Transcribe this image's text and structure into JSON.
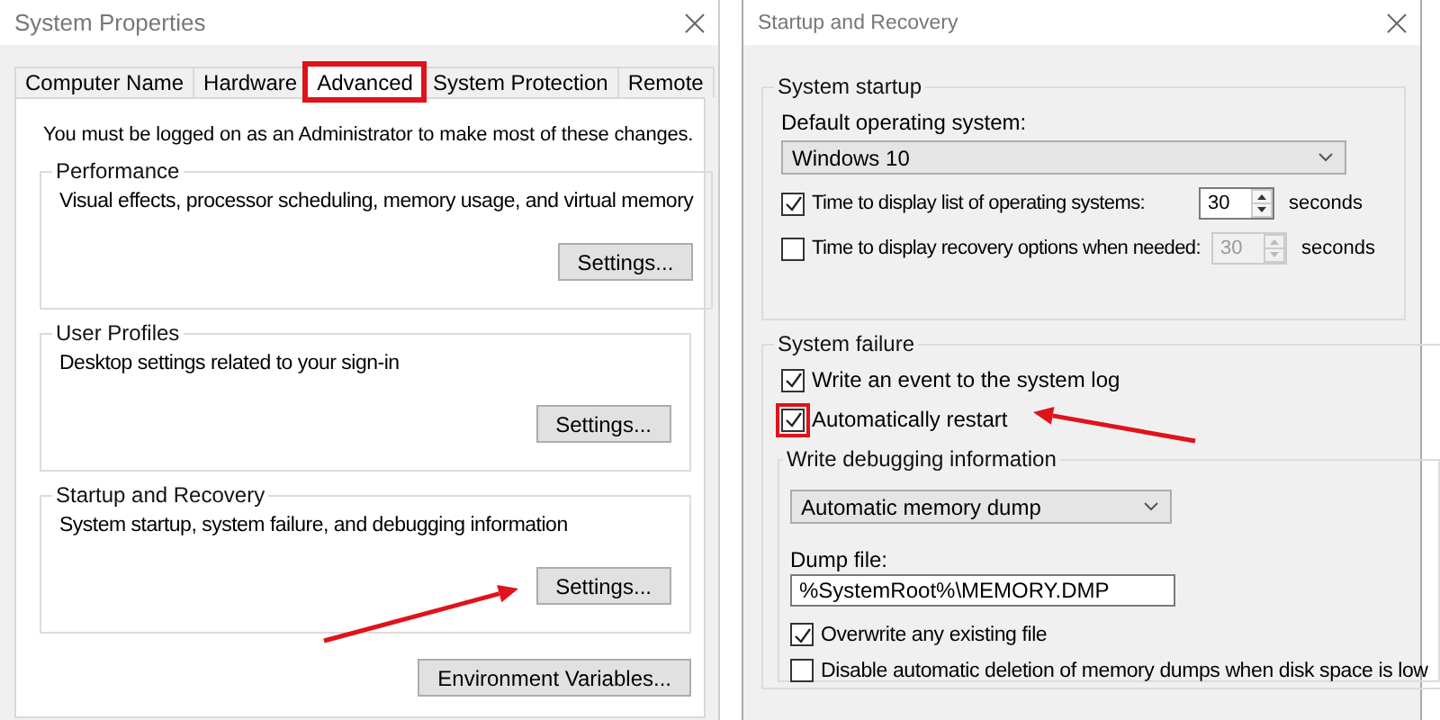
{
  "system_properties": {
    "title": "System Properties",
    "tabs": [
      {
        "label": "Computer Name",
        "selected": false,
        "highlighted": false
      },
      {
        "label": "Hardware",
        "selected": false,
        "highlighted": false
      },
      {
        "label": "Advanced",
        "selected": true,
        "highlighted": true
      },
      {
        "label": "System Protection",
        "selected": false,
        "highlighted": false
      },
      {
        "label": "Remote",
        "selected": false,
        "highlighted": false
      }
    ],
    "notice": "You must be logged on as an Administrator to make most of these changes.",
    "groups": [
      {
        "title": "Performance",
        "description": "Visual effects, processor scheduling, memory usage, and virtual memory",
        "button": "Settings...",
        "arrow": false
      },
      {
        "title": "User Profiles",
        "description": "Desktop settings related to your sign-in",
        "button": "Settings...",
        "arrow": false
      },
      {
        "title": "Startup and Recovery",
        "description": "System startup, system failure, and debugging information",
        "button": "Settings...",
        "arrow": true
      }
    ],
    "env_button": "Environment Variables..."
  },
  "startup_recovery": {
    "title": "Startup and Recovery",
    "system_startup": {
      "title": "System startup",
      "default_os_label": "Default operating system:",
      "default_os": "Windows 10",
      "timers": [
        {
          "label": "Time to display list of operating systems:",
          "checked": true,
          "value": "30",
          "unit": "seconds",
          "disabled": false
        },
        {
          "label": "Time to display recovery options when needed:",
          "checked": false,
          "value": "30",
          "unit": "seconds",
          "disabled": true
        }
      ]
    },
    "system_failure": {
      "title": "System failure",
      "options": [
        {
          "label": "Write an event to the system log",
          "checked": true,
          "highlighted": false,
          "arrow": false
        },
        {
          "label": "Automatically restart",
          "checked": true,
          "highlighted": true,
          "arrow": true
        }
      ],
      "debugging": {
        "title": "Write debugging information",
        "dump_type": "Automatic memory dump",
        "dump_file_label": "Dump file:",
        "dump_file": "%SystemRoot%\\MEMORY.DMP",
        "options": [
          {
            "label": "Overwrite any existing file",
            "checked": true
          },
          {
            "label": "Disable automatic deletion of memory dumps when disk space is low",
            "checked": false
          }
        ]
      }
    }
  }
}
